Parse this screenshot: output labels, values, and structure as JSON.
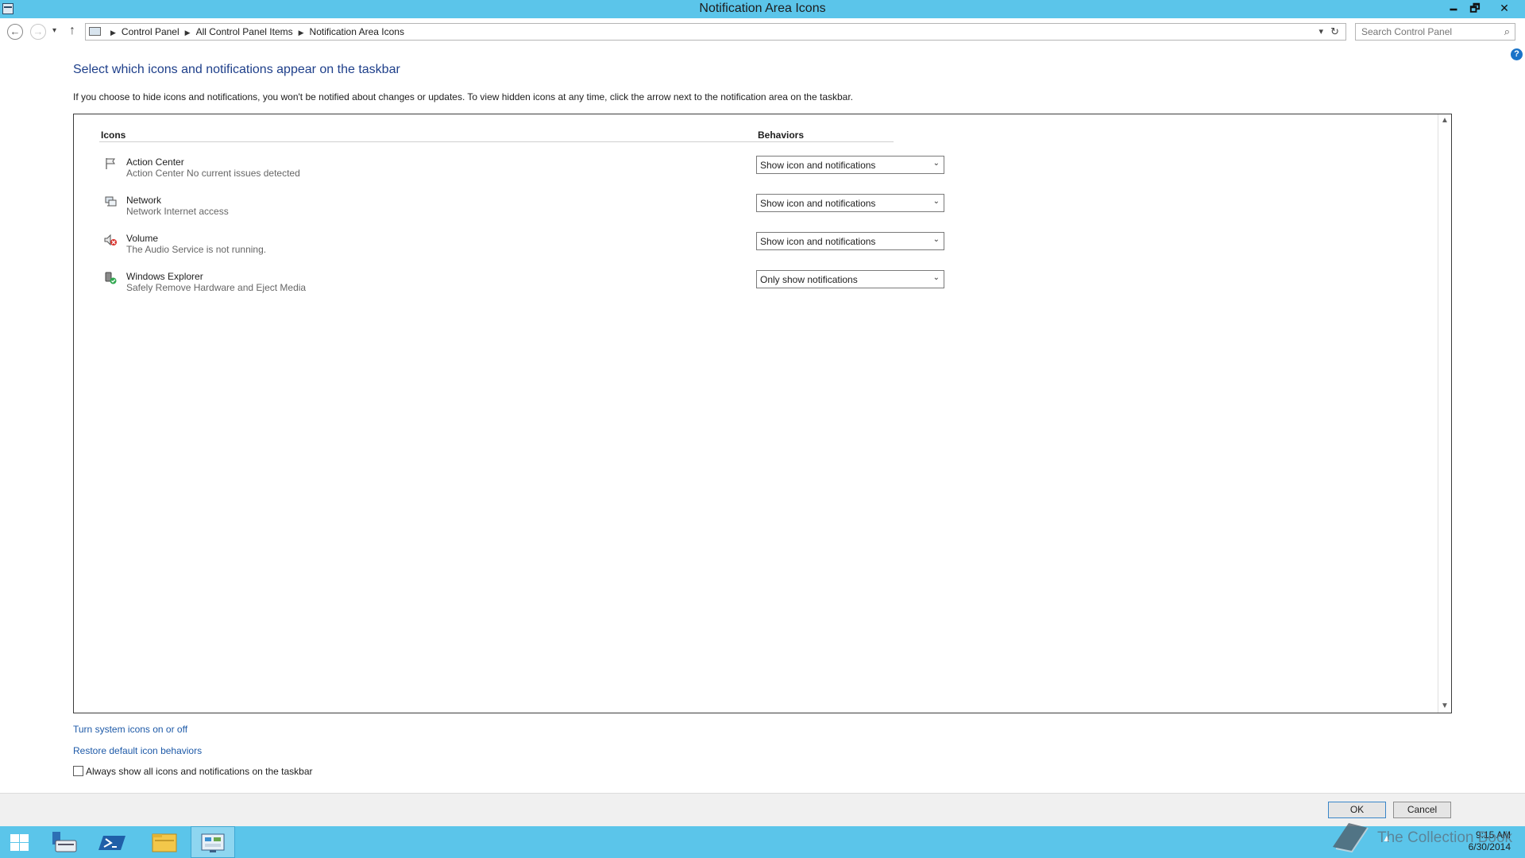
{
  "window": {
    "title": "Notification Area Icons",
    "minimize": "🗕",
    "maximize": "🗗",
    "close": "✕"
  },
  "nav": {
    "back": "←",
    "forward": "→",
    "up": "↑",
    "recent": "▾",
    "breadcrumbs": [
      "Control Panel",
      "All Control Panel Items",
      "Notification Area Icons"
    ],
    "search_placeholder": "Search Control Panel"
  },
  "help": "?",
  "page": {
    "title": "Select which icons and notifications appear on the taskbar",
    "description": "If you choose to hide icons and notifications, you won't be notified about changes or updates. To view hidden icons at any time, click the arrow next to the notification area on the taskbar."
  },
  "table": {
    "col_icons": "Icons",
    "col_behaviors": "Behaviors",
    "rows": [
      {
        "name": "Action Center",
        "sub": "Action Center  No current issues detected",
        "behavior": "Show icon and notifications",
        "icon": "flag-icon"
      },
      {
        "name": "Network",
        "sub": "Network Internet access",
        "behavior": "Show icon and notifications",
        "icon": "network-icon"
      },
      {
        "name": "Volume",
        "sub": "The Audio Service is not running.",
        "behavior": "Show icon and notifications",
        "icon": "volume-muted-icon"
      },
      {
        "name": "Windows Explorer",
        "sub": "Safely Remove Hardware and Eject Media",
        "behavior": "Only show notifications",
        "icon": "safely-remove-icon"
      }
    ]
  },
  "links": {
    "system_icons": "Turn system icons on or off",
    "restore": "Restore default icon behaviors"
  },
  "always_show": {
    "label": "Always show all icons and notifications on the taskbar",
    "checked": false
  },
  "buttons": {
    "ok": "OK",
    "cancel": "Cancel"
  },
  "taskbar": {
    "time": "9:15 AM",
    "date": "6/30/2014",
    "tray_overflow": "▲"
  },
  "watermark": "The Collection Book",
  "colors": {
    "accent": "#5bc5ea",
    "link": "#1e5aa8",
    "title": "#1e3f8a"
  }
}
